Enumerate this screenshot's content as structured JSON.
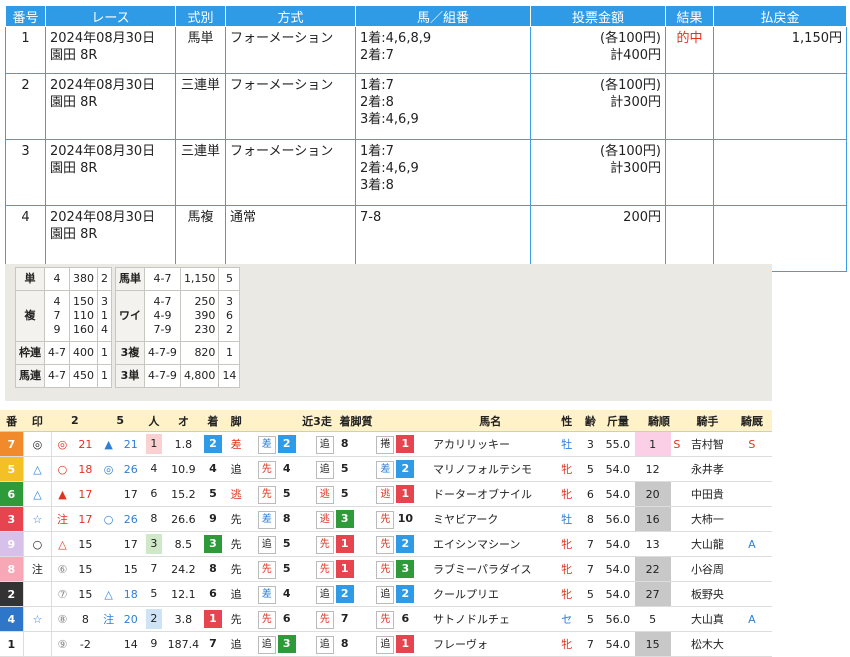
{
  "bets": {
    "headers": [
      "番号",
      "レース",
      "式別",
      "方式",
      "馬／組番",
      "投票金額",
      "結果",
      "払戻金"
    ],
    "rows": [
      {
        "no": "1",
        "race": "2024年08月30日\n園田 8R",
        "type": "馬単",
        "method": "フォーメーション",
        "combo": "1着:4,6,8,9\n2着:7",
        "amount": "(各100円)\n計400円",
        "result": "的中",
        "payout": "1,150円"
      },
      {
        "no": "2",
        "race": "2024年08月30日\n園田 8R",
        "type": "三連単",
        "method": "フォーメーション",
        "combo": "1着:7\n2着:8\n3着:4,6,9",
        "amount": "(各100円)\n計300円",
        "result": "",
        "payout": ""
      },
      {
        "no": "3",
        "race": "2024年08月30日\n園田 8R",
        "type": "三連単",
        "method": "フォーメーション",
        "combo": "1着:7\n2着:4,6,9\n3着:8",
        "amount": "(各100円)\n計300円",
        "result": "",
        "payout": ""
      },
      {
        "no": "4",
        "race": "2024年08月30日\n園田 8R",
        "type": "馬複",
        "method": "通常",
        "combo": "7-8",
        "amount": "200円",
        "result": "",
        "payout": ""
      }
    ]
  },
  "payouts": {
    "left": [
      {
        "k": "単",
        "a": "4",
        "b": "380",
        "c": "2"
      },
      {
        "k": "複",
        "a": "4\n7\n9",
        "b": "150\n110\n160",
        "c": "3\n1\n4"
      },
      {
        "k": "枠連",
        "a": "4-7",
        "b": "400",
        "c": "1"
      },
      {
        "k": "馬連",
        "a": "4-7",
        "b": "450",
        "c": "1"
      }
    ],
    "right": [
      {
        "k": "馬単",
        "a": "4-7",
        "b": "1,150",
        "c": "5"
      },
      {
        "k": "ワイ",
        "a": "4-7\n4-9\n7-9",
        "b": "250\n390\n230",
        "c": "3\n6\n2"
      },
      {
        "k": "3複",
        "a": "4-7-9",
        "b": "820",
        "c": "1"
      },
      {
        "k": "3単",
        "a": "4-7-9",
        "b": "4,800",
        "c": "14"
      }
    ]
  },
  "horses": {
    "headers": {
      "ban": "番",
      "shirushi": "印",
      "two": "2",
      "five": "5",
      "ninki": "人",
      "odds": "オ",
      "chaku": "着",
      "kyaku": "脚",
      "kinsou": "近3走",
      "chakukyaku": "着脚質",
      "name": "馬名",
      "sex": "性",
      "age": "齢",
      "weight": "斤量",
      "kijun": "騎順",
      "jockey": "騎手",
      "kisen": "騎厩"
    },
    "rows": [
      {
        "ban": "7",
        "bancolor": "#f08a2a",
        "mark": "◎",
        "m2": "◎",
        "n2": "21",
        "m5": "▲",
        "n5": "21",
        "ninki": "1",
        "odds": "1.8",
        "chaku": "2",
        "kyaku": "差",
        "r1s": "差",
        "r1n": "2",
        "r2s": "追",
        "r2n": "8",
        "r3s": "捲",
        "r3n": "1",
        "name": "アカリリッキー",
        "sex": "牡",
        "age": "3",
        "wt": "55.0",
        "kj": "1",
        "s": "S",
        "jockey": "吉村智",
        "kisen": "S"
      },
      {
        "ban": "5",
        "bancolor": "#f3c026",
        "mark": "△",
        "m2": "○",
        "n2": "18",
        "m5": "◎",
        "n5": "26",
        "ninki": "4",
        "odds": "10.9",
        "chaku": "4",
        "kyaku": "追",
        "r1s": "先",
        "r1n": "4",
        "r2s": "追",
        "r2n": "5",
        "r3s": "差",
        "r3n": "2",
        "name": "マリノフォルテシモ",
        "sex": "牝",
        "age": "5",
        "wt": "54.0",
        "kj": "12",
        "s": "",
        "jockey": "永井孝",
        "kisen": ""
      },
      {
        "ban": "6",
        "bancolor": "#2f9a3a",
        "mark": "△",
        "m2": "▲",
        "n2": "17",
        "m5": "",
        "n5": "17",
        "ninki": "6",
        "odds": "15.2",
        "chaku": "5",
        "kyaku": "逃",
        "r1s": "先",
        "r1n": "5",
        "r2s": "逃",
        "r2n": "5",
        "r3s": "逃",
        "r3n": "1",
        "name": "ドーターオブナイル",
        "sex": "牝",
        "age": "6",
        "wt": "54.0",
        "kj": "20",
        "s": "",
        "jockey": "中田貴",
        "kisen": ""
      },
      {
        "ban": "3",
        "bancolor": "#e6454f",
        "mark": "☆",
        "m2": "注",
        "n2": "17",
        "m5": "○",
        "n5": "26",
        "ninki": "8",
        "odds": "26.6",
        "chaku": "9",
        "kyaku": "先",
        "r1s": "差",
        "r1n": "8",
        "r2s": "逃",
        "r2n": "3",
        "r3s": "先",
        "r3n": "10",
        "name": "ミヤビアーク",
        "sex": "牡",
        "age": "8",
        "wt": "56.0",
        "kj": "16",
        "s": "",
        "jockey": "大柿一",
        "kisen": ""
      },
      {
        "ban": "9",
        "bancolor": "#d7c0ea",
        "mark": "○",
        "m2": "△",
        "n2": "15",
        "m5": "",
        "n5": "17",
        "ninki": "3",
        "odds": "8.5",
        "chaku": "3",
        "kyaku": "先",
        "r1s": "追",
        "r1n": "5",
        "r2s": "先",
        "r2n": "1",
        "r3s": "先",
        "r3n": "2",
        "name": "エイシンマシーン",
        "sex": "牝",
        "age": "7",
        "wt": "54.0",
        "kj": "13",
        "s": "",
        "jockey": "大山龍",
        "kisen": "A"
      },
      {
        "ban": "8",
        "bancolor": "#f7a7b6",
        "mark": "注",
        "m2": "⑥",
        "n2": "15",
        "m5": "",
        "n5": "15",
        "ninki": "7",
        "odds": "24.2",
        "chaku": "8",
        "kyaku": "先",
        "r1s": "先",
        "r1n": "5",
        "r2s": "先",
        "r2n": "1",
        "r3s": "先",
        "r3n": "3",
        "name": "ラブミーパラダイス",
        "sex": "牝",
        "age": "7",
        "wt": "54.0",
        "kj": "22",
        "s": "",
        "jockey": "小谷周",
        "kisen": ""
      },
      {
        "ban": "2",
        "bancolor": "#333333",
        "mark": "",
        "m2": "⑦",
        "n2": "15",
        "m5": "△",
        "n5": "18",
        "ninki": "5",
        "odds": "12.1",
        "chaku": "6",
        "kyaku": "追",
        "r1s": "差",
        "r1n": "4",
        "r2s": "追",
        "r2n": "2",
        "r3s": "追",
        "r3n": "2",
        "name": "クールプリエ",
        "sex": "牝",
        "age": "5",
        "wt": "54.0",
        "kj": "27",
        "s": "",
        "jockey": "板野央",
        "kisen": ""
      },
      {
        "ban": "4",
        "bancolor": "#2d76c9",
        "mark": "☆",
        "m2": "⑧",
        "n2": "8",
        "m5": "注",
        "n5": "20",
        "ninki": "2",
        "odds": "3.8",
        "chaku": "1",
        "kyaku": "先",
        "r1s": "先",
        "r1n": "6",
        "r2s": "先",
        "r2n": "7",
        "r3s": "先",
        "r3n": "6",
        "name": "サトノドルチェ",
        "sex": "セ",
        "age": "5",
        "wt": "56.0",
        "kj": "5",
        "s": "",
        "jockey": "大山真",
        "kisen": "A"
      },
      {
        "ban": "1",
        "bancolor": "#ffffff",
        "mark": "",
        "m2": "⑨",
        "n2": "-2",
        "m5": "",
        "n5": "14",
        "ninki": "9",
        "odds": "187.4",
        "chaku": "7",
        "kyaku": "追",
        "r1s": "追",
        "r1n": "3",
        "r2s": "追",
        "r2n": "8",
        "r3s": "追",
        "r3n": "1",
        "name": "フレーヴォ",
        "sex": "牝",
        "age": "7",
        "wt": "54.0",
        "kj": "15",
        "s": "",
        "jockey": "松木大",
        "kisen": ""
      }
    ]
  }
}
